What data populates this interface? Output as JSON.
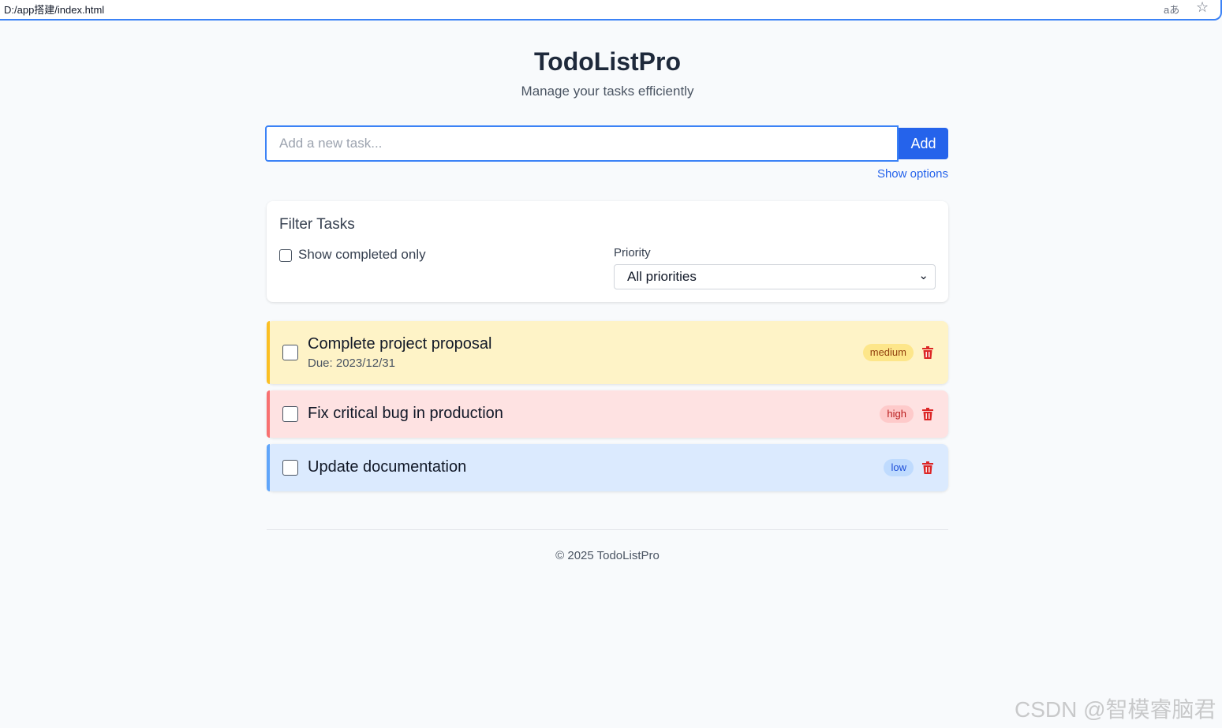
{
  "browser": {
    "url": "D:/app搭建/index.html",
    "translate_icon": "aあ"
  },
  "header": {
    "title": "TodoListPro",
    "subtitle": "Manage your tasks efficiently"
  },
  "add_task": {
    "placeholder": "Add a new task...",
    "value": "",
    "button_label": "Add",
    "options_link": "Show options"
  },
  "filter": {
    "title": "Filter Tasks",
    "completed_only_label": "Show completed only",
    "completed_only_checked": false,
    "priority_label": "Priority",
    "priority_selected": "All priorities"
  },
  "tasks": [
    {
      "title": "Complete project proposal",
      "due": "Due: 2023/12/31",
      "priority": "medium",
      "completed": false,
      "colors": {
        "bg": "#fef3c7",
        "bar": "#fbbf24",
        "badge_bg": "#fde68a",
        "badge_text": "#92400e"
      }
    },
    {
      "title": "Fix critical bug in production",
      "due": "",
      "priority": "high",
      "completed": false,
      "colors": {
        "bg": "#fee2e2",
        "bar": "#f87171",
        "badge_bg": "#fecaca",
        "badge_text": "#b91c1c"
      }
    },
    {
      "title": "Update documentation",
      "due": "",
      "priority": "low",
      "completed": false,
      "colors": {
        "bg": "#dbeafe",
        "bar": "#60a5fa",
        "badge_bg": "#bfdbfe",
        "badge_text": "#1d4ed8"
      }
    }
  ],
  "footer": {
    "text": "© 2025 TodoListPro"
  },
  "watermark": "CSDN @智模睿脑君",
  "theme": {
    "accent": "#2563eb",
    "delete": "#dc2626",
    "page_bg": "#f8fafc"
  },
  "icons": {
    "delete": "trash-icon",
    "bookmark": "star-icon",
    "dropdown": "chevron-down-icon"
  }
}
